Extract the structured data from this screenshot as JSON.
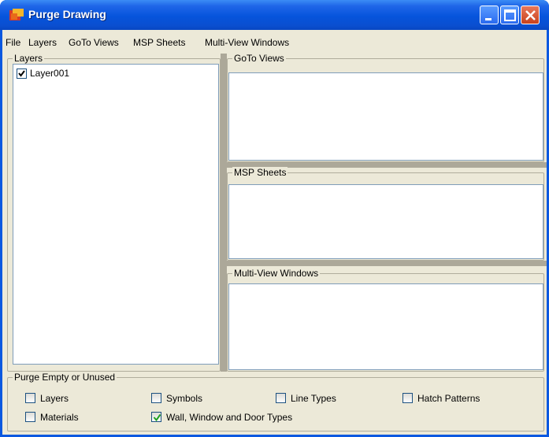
{
  "window": {
    "title": "Purge Drawing"
  },
  "menu": [
    "File",
    "Layers",
    "GoTo Views",
    "MSP Sheets",
    "Multi-View Windows"
  ],
  "panels": {
    "layers": {
      "label": "Layers",
      "items": [
        {
          "label": "Layer001",
          "checked": true
        }
      ]
    },
    "goto_views": {
      "label": "GoTo Views"
    },
    "msp_sheets": {
      "label": "MSP Sheets"
    },
    "multiview_windows": {
      "label": "Multi-View Windows"
    }
  },
  "purge": {
    "label": "Purge Empty or Unused",
    "options": [
      {
        "label": "Layers",
        "checked": false
      },
      {
        "label": "Symbols",
        "checked": false
      },
      {
        "label": "Line Types",
        "checked": false
      },
      {
        "label": "Hatch Patterns",
        "checked": false
      },
      {
        "label": "Materials",
        "checked": false
      },
      {
        "label": "Wall, Window and Door Types",
        "checked": true
      }
    ]
  },
  "colors": {
    "titlebar": "#0654dc",
    "face": "#ece9d8",
    "check": "#21a121"
  }
}
